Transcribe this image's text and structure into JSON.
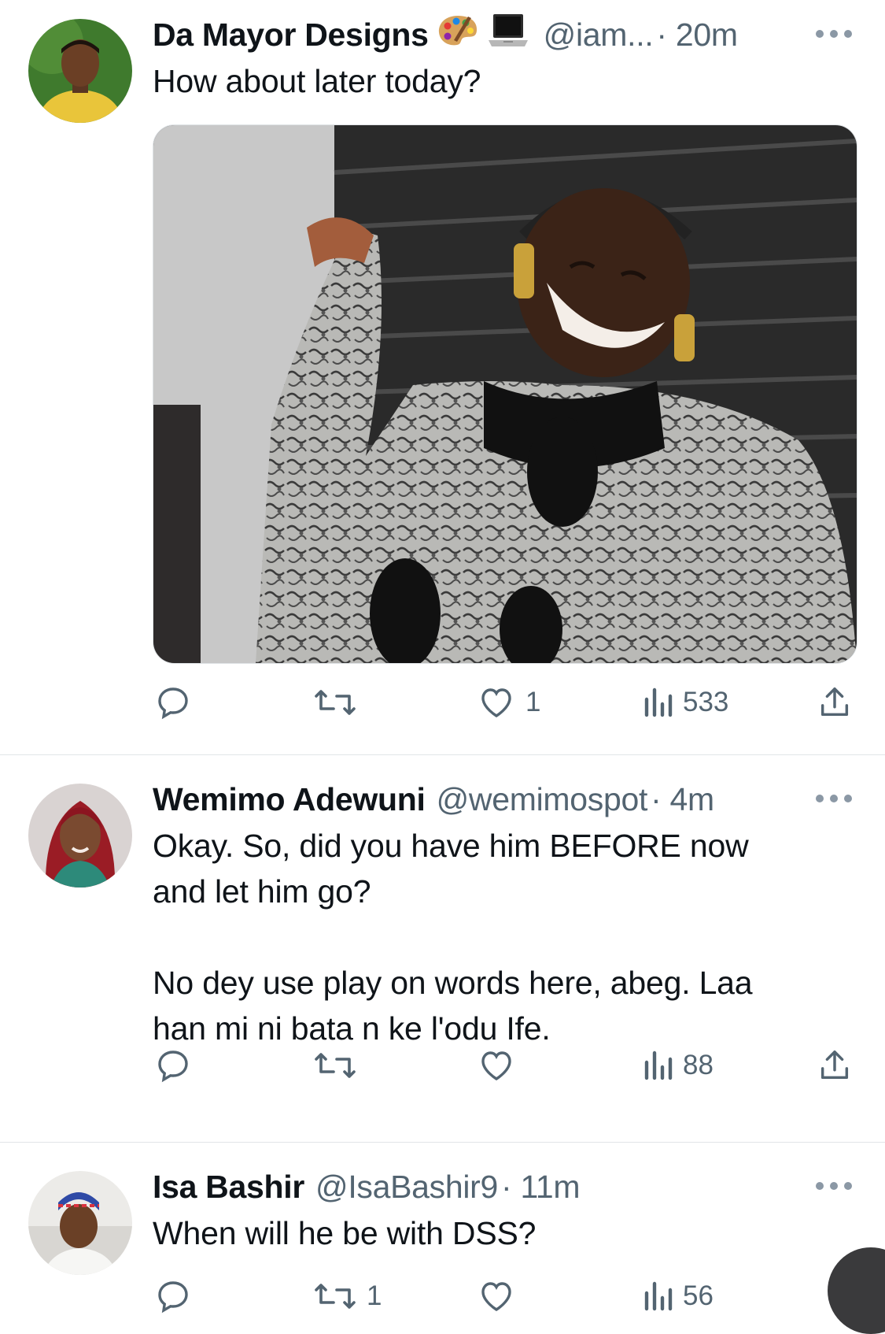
{
  "tweets": [
    {
      "name": "Da Mayor Designs",
      "name_emoji": [
        "artist-palette-icon",
        "laptop-icon"
      ],
      "handle": "@iam...",
      "time": "· 20m",
      "text": "How about later today?",
      "has_media": true,
      "media_description_icon": "gif-video-thumbnail",
      "actions": {
        "replies": "",
        "retweets": "",
        "likes": "1",
        "views": "533"
      }
    },
    {
      "name": "Wemimo Adewuni",
      "handle": "@wemimospot",
      "time": "· 4m",
      "text_lines": [
        "Okay. So, did you have him BEFORE now",
        "and let him go?",
        "",
        "No dey use play on words here, abeg. Laa",
        "han mi ni bata n ke l'odu Ife."
      ],
      "actions": {
        "replies": "",
        "retweets": "",
        "likes": "",
        "views": "88"
      }
    },
    {
      "name": "Isa Bashir",
      "handle": "@IsaBashir9",
      "time": "· 11m",
      "text": "When will he be with DSS?",
      "actions": {
        "replies": "",
        "retweets": "1",
        "likes": "",
        "views": "56"
      }
    }
  ],
  "colors": {
    "text_primary": "#0f1419",
    "text_secondary": "#536471",
    "divider": "#e1e5e8",
    "icon": "#536471"
  }
}
